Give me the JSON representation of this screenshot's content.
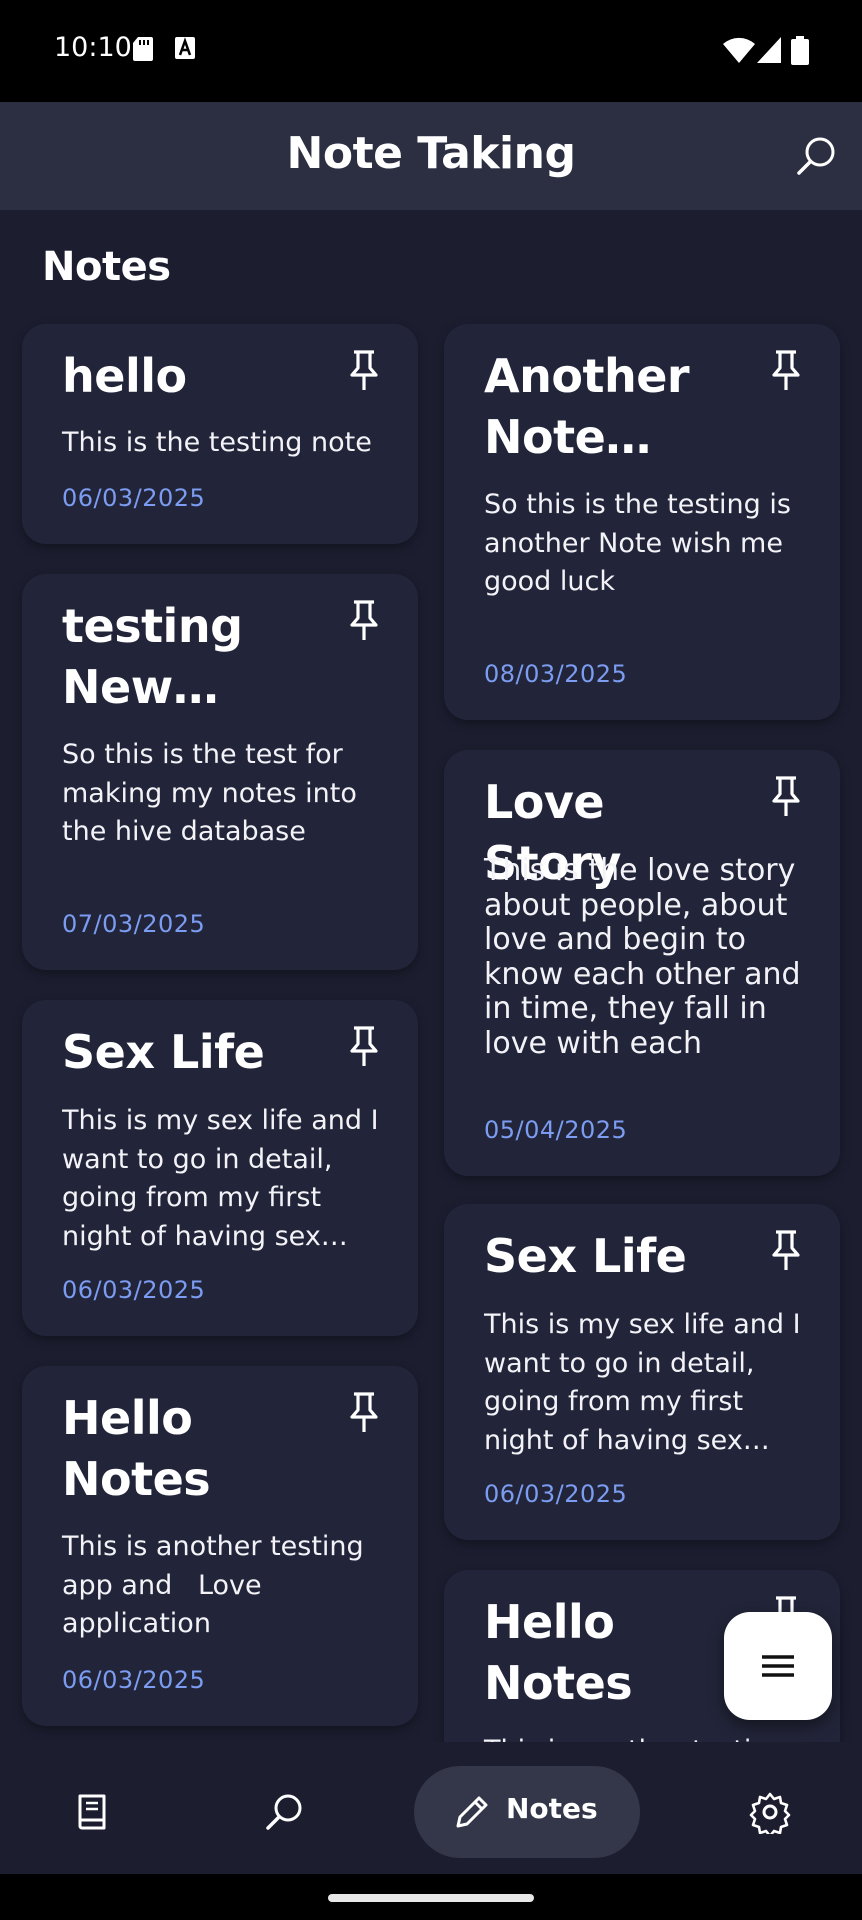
{
  "status_bar": {
    "time": "10:10"
  },
  "app_bar": {
    "title": "Note Taking"
  },
  "section": {
    "title": "Notes"
  },
  "notes": [
    {
      "title": "hello",
      "body": "This is the testing note",
      "date": "06/03/2025"
    },
    {
      "title": "Another Note ano...",
      "body": "So this is the testing is another Note wish me good luck",
      "date": "08/03/2025"
    },
    {
      "title": "testing New app...",
      "body": "So this is the test for making my notes into the hive database",
      "date": "07/03/2025"
    },
    {
      "title": "Love Story",
      "body": "This is the love story about people, about love and begin to know each other and in time, they fall in love with each",
      "date": "05/04/2025"
    },
    {
      "title": "Sex Life",
      "body": "This is my sex life and I want to go in detail, going from my first night of having sex wi...",
      "date": "06/03/2025"
    },
    {
      "title": "Sex Life",
      "body": "This is my sex life and I want to go in detail, going from my first night of having sex wi...",
      "date": "06/03/2025"
    },
    {
      "title": "Hello Notes",
      "body": "This is another testing app and   Love application",
      "date": "06/03/2025"
    },
    {
      "title": "Hello Notes",
      "body": "This is another testing",
      "date": ""
    }
  ],
  "bottom_nav": {
    "items": [
      {
        "icon": "book-icon"
      },
      {
        "icon": "search-icon"
      },
      {
        "icon": "pencil-icon",
        "label": "Notes",
        "selected": true
      },
      {
        "icon": "gear-icon"
      }
    ]
  },
  "colors": {
    "background": "#1c1e30",
    "app_bar": "#2c2f42",
    "card": "#222539",
    "date": "#7b9cf0",
    "nav_selected": "#34374a"
  }
}
